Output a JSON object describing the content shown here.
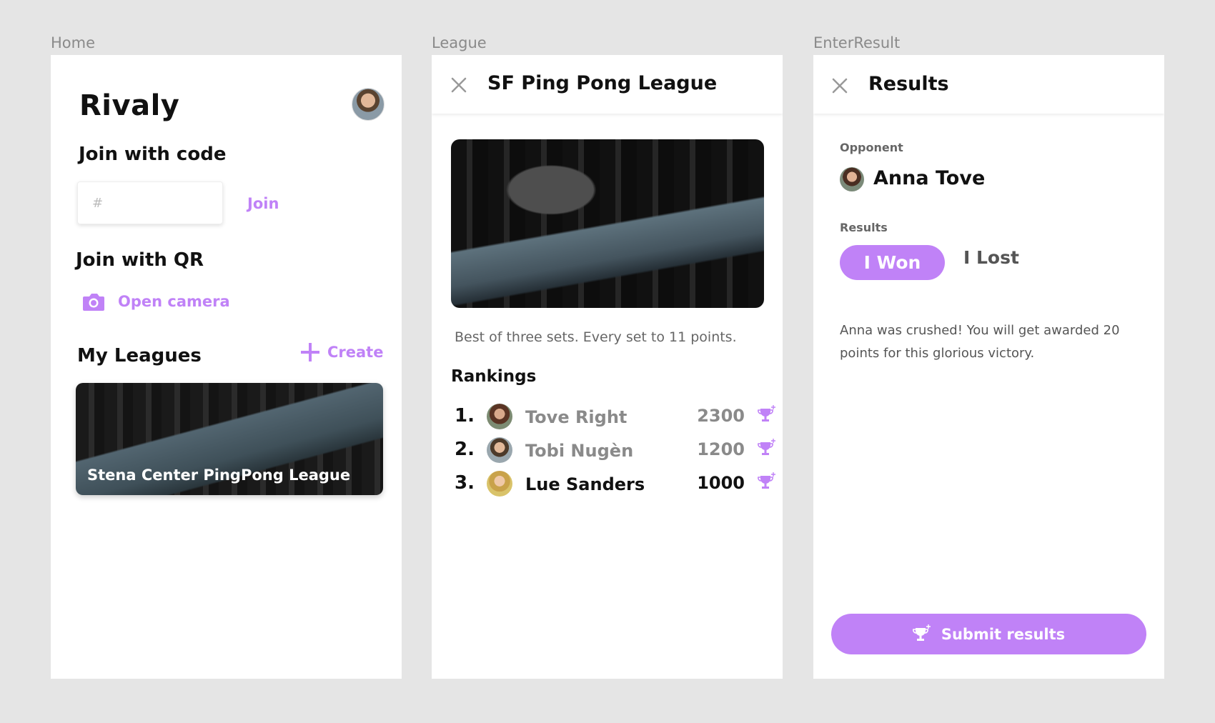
{
  "frames": {
    "home": "Home",
    "league": "League",
    "enter_result": "EnterResult"
  },
  "colors": {
    "accent": "#c082f7",
    "background": "#e5e5e5"
  },
  "home": {
    "app_title": "Rivaly",
    "join_code_heading": "Join with code",
    "code_placeholder": "#",
    "join_label": "Join",
    "join_qr_heading": "Join with QR",
    "open_camera_label": "Open camera",
    "my_leagues_heading": "My Leagues",
    "create_label": "Create",
    "leagues": [
      {
        "name": "Stena Center PingPong League"
      }
    ]
  },
  "league": {
    "title": "SF Ping Pong League",
    "description": "Best of three sets. Every set to 11 points.",
    "rankings_heading": "Rankings",
    "rankings": [
      {
        "rank": "1.",
        "name": "Tove Right",
        "score": "2300"
      },
      {
        "rank": "2.",
        "name": "Tobi Nugèn",
        "score": "1200"
      },
      {
        "rank": "3.",
        "name": "Lue Sanders",
        "score": "1000"
      }
    ]
  },
  "results": {
    "title": "Results",
    "opponent_label": "Opponent",
    "opponent_name": "Anna Tove",
    "results_label": "Results",
    "won_label": "I Won",
    "lost_label": "I Lost",
    "message": "Anna was crushed! You will get awarded 20 points for this  glorious victory.",
    "submit_label": "Submit results"
  }
}
